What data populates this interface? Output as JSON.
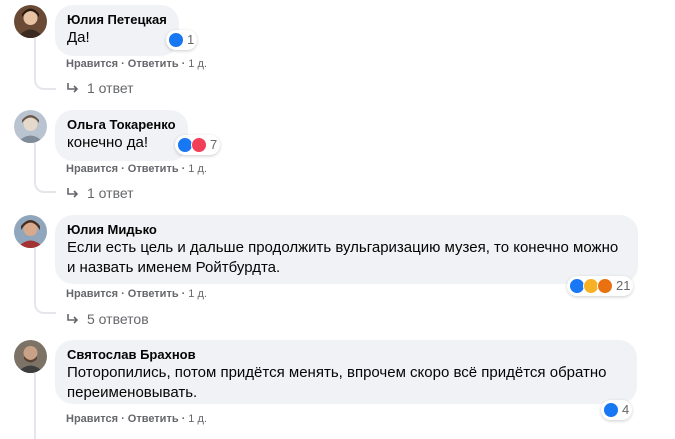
{
  "ui": {
    "like_label": "Нравится",
    "reply_label": "Ответить",
    "separator": "·"
  },
  "comments": [
    {
      "author": "Юлия Петецкая",
      "text": "Да!",
      "reactions": [
        "like"
      ],
      "reaction_count": "1",
      "time": "1 д.",
      "replies_label": "1 ответ"
    },
    {
      "author": "Ольга Токаренко",
      "text": "конечно да!",
      "reactions": [
        "like",
        "love"
      ],
      "reaction_count": "7",
      "time": "1 д.",
      "replies_label": "1 ответ"
    },
    {
      "author": "Юлия Мидько",
      "text": "Если есть цель и дальше продолжить вульгаризацию музея, то конечно можно\nи назвать именем Ройтбурдта.",
      "reactions": [
        "like",
        "haha",
        "angry"
      ],
      "reaction_count": "21",
      "time": "1 д.",
      "replies_label": "5 ответов"
    },
    {
      "author": "Святослав Брахнов",
      "text": "Поторопились, потом придётся менять, впрочем скоро всё придётся обратно\nпереименовывать.",
      "reactions": [
        "like"
      ],
      "reaction_count": "4",
      "time": "1 д.",
      "replies_label": ""
    }
  ],
  "colors": {
    "like": "#1877f2",
    "love": "#f33e58",
    "haha": "#f7b125",
    "angry": "#e9710f"
  }
}
